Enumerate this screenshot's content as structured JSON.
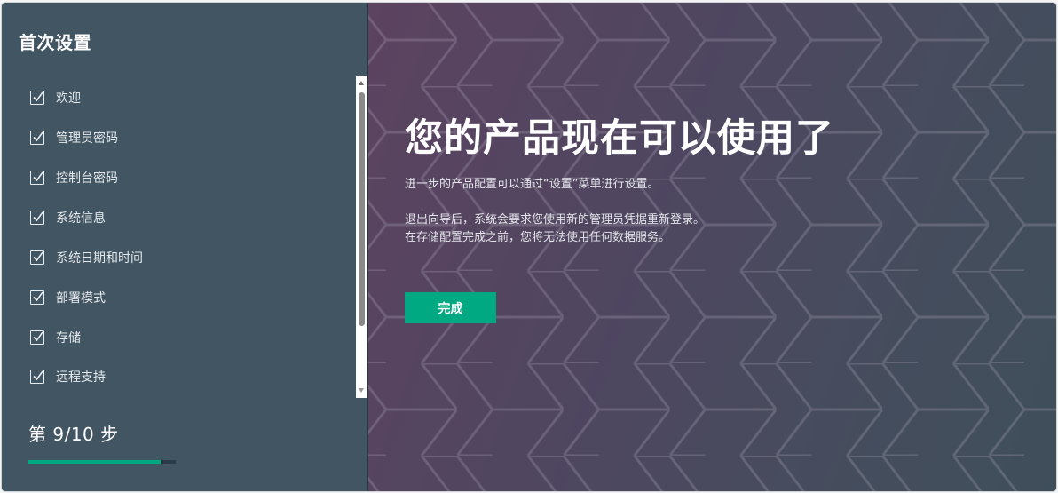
{
  "sidebar": {
    "title": "首次设置",
    "items": [
      {
        "label": "欢迎",
        "checked": true
      },
      {
        "label": "管理员密码",
        "checked": true
      },
      {
        "label": "控制台密码",
        "checked": true
      },
      {
        "label": "系统信息",
        "checked": true
      },
      {
        "label": "系统日期和时间",
        "checked": true
      },
      {
        "label": "部署模式",
        "checked": true
      },
      {
        "label": "存储",
        "checked": true
      },
      {
        "label": "远程支持",
        "checked": true
      }
    ],
    "step_counter": "第 9/10 步",
    "progress_fraction": 0.9
  },
  "main": {
    "heading": "您的产品现在可以使用了",
    "line1": "进一步的产品配置可以通过“设置”菜单进行设置。",
    "line2": "退出向导后，系统会要求您使用新的管理员凭据重新登录。",
    "line3": "在存储配置完成之前，您将无法使用任何数据服务。",
    "finish_label": "完成"
  },
  "colors": {
    "sidebar_bg": "#425563",
    "accent": "#01a982",
    "text": "#ffffff"
  },
  "icons": {
    "checkbox": "checkbox-checked-icon"
  }
}
